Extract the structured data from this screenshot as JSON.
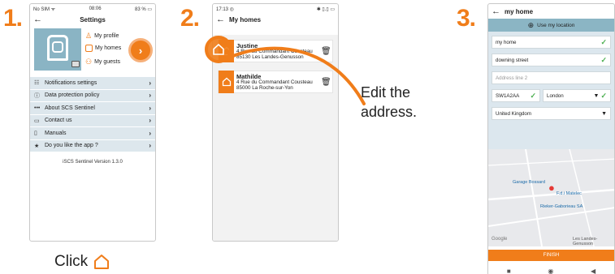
{
  "steps": [
    "1.",
    "2.",
    "3."
  ],
  "phone1": {
    "status_left": "No SIM ᯤ",
    "status_center": "08:06",
    "status_right": "83 % ▭",
    "title": "Settings",
    "links": [
      "My profile",
      "My homes",
      "My guests"
    ],
    "menu": [
      {
        "icon": "sliders-icon",
        "glyph": "☷",
        "label": "Notifications settings"
      },
      {
        "icon": "info-icon",
        "glyph": "ⓘ",
        "label": "Data protection policy"
      },
      {
        "icon": "dots-icon",
        "glyph": "•••",
        "label": "About SCS Sentinel"
      },
      {
        "icon": "chat-icon",
        "glyph": "▭",
        "label": "Contact us"
      },
      {
        "icon": "document-icon",
        "glyph": "▯",
        "label": "Manuals"
      },
      {
        "icon": "star-icon",
        "glyph": "★",
        "label": "Do you like the app ?"
      }
    ],
    "version": "iSCS Sentinel Version 1.3.0",
    "chevron": "›"
  },
  "caption_click": "Click",
  "phone2": {
    "status_left": "17:13 ◎",
    "status_right": "✱ ▯.▯ ▭",
    "title": "My homes",
    "homes": [
      {
        "name": "Justine",
        "line1": "4 Rue du Commandant Cousteau",
        "line2": "85130 Les Landes-Genusson"
      },
      {
        "name": "Mathilde",
        "line1": "4 Rue du Commandant Cousteau",
        "line2": "85000 La Roche-sur-Yon"
      }
    ]
  },
  "caption_edit": [
    "Edit the",
    "address."
  ],
  "phone3": {
    "title": "my home",
    "use_location": "Use my location",
    "fields": {
      "name": "my home",
      "street": "downing street",
      "line2_placeholder": "Address line 2",
      "postcode": "SW1A2AA",
      "city": "London",
      "country": "United Kingdom"
    },
    "map_labels": [
      "Garage Bossard",
      "F.d.i Matelec",
      "Rieker-Gaborieau SA",
      "Google",
      "Les Landes-Genusson"
    ],
    "finish": "FINISH"
  },
  "colors": {
    "accent": "#f07d1a",
    "teal": "#8bb5c4",
    "menu_bg": "#dde7ed",
    "check": "#4caf50"
  }
}
